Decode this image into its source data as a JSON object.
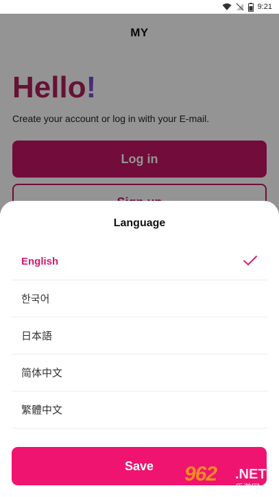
{
  "status_bar": {
    "time": "9:21"
  },
  "app": {
    "title": "MY",
    "hello": "Hello",
    "hello_mark": "!",
    "subtitle": "Create your account or log in with your E-mail.",
    "login_label": "Log in",
    "signup_label": "Sign up"
  },
  "sheet": {
    "title": "Language",
    "languages": [
      {
        "label": "English",
        "selected": true
      },
      {
        "label": "한국어",
        "selected": false
      },
      {
        "label": "日本語",
        "selected": false
      },
      {
        "label": "简体中文",
        "selected": false
      },
      {
        "label": "繁體中文",
        "selected": false
      }
    ],
    "save_label": "Save"
  },
  "watermark": {
    "number": "962",
    "suffix": ".NET",
    "site": "乐游网"
  },
  "colors": {
    "accent": "#ee1470",
    "selected_text": "#d6176f",
    "login_bg": "#c41565",
    "overlay": "rgba(0,0,0,0.42)"
  }
}
